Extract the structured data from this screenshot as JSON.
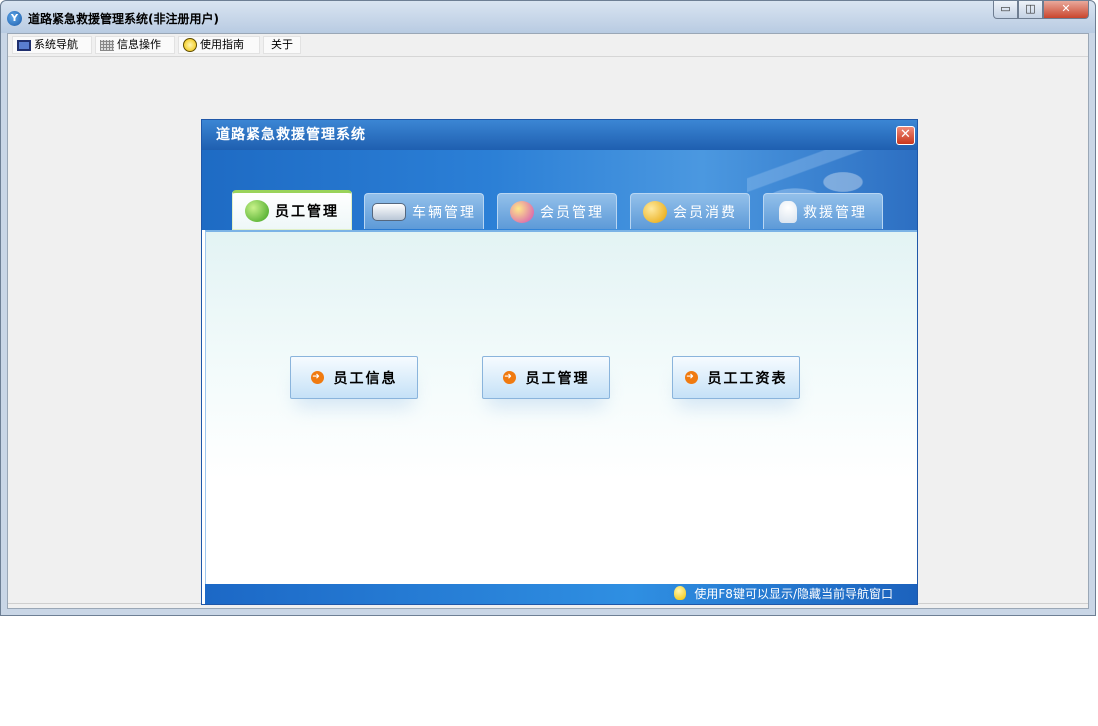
{
  "window": {
    "title": "道路紧急救援管理系统(非注册用户)",
    "app_icon_text": "Y",
    "minimize_label": "▭",
    "restore_label": "◫",
    "close_label": "✕"
  },
  "menubar": {
    "items": [
      {
        "label": "系统导航",
        "icon": "nav-icon"
      },
      {
        "label": "信息操作",
        "icon": "grid-icon"
      },
      {
        "label": "使用指南",
        "icon": "guide-icon"
      },
      {
        "label": "关于",
        "icon": ""
      }
    ]
  },
  "dialog": {
    "title": "道路紧急救援管理系统",
    "close_label": "✕",
    "tabs": [
      {
        "label": "员工管理",
        "icon": "staff-icon",
        "active": true
      },
      {
        "label": "车辆管理",
        "icon": "car-icon",
        "active": false
      },
      {
        "label": "会员管理",
        "icon": "member-icon",
        "active": false
      },
      {
        "label": "会员消费",
        "icon": "consume-icon",
        "active": false
      },
      {
        "label": "救援管理",
        "icon": "rescue-icon",
        "active": false
      }
    ],
    "buttons": [
      {
        "label": "员工信息",
        "icon": "arrow-right-icon"
      },
      {
        "label": "员工管理",
        "icon": "arrow-right-icon"
      },
      {
        "label": "员工工资表",
        "icon": "arrow-right-icon"
      }
    ],
    "arrow_glyph": "➜",
    "footer_hint": "使用F8键可以显示/隐藏当前导航窗口"
  },
  "colors": {
    "dialog_title": "#1f5fb0",
    "tab_active_border": "#9ad35a",
    "footer": "#2f8fe2",
    "button_icon": "#f07a10"
  }
}
